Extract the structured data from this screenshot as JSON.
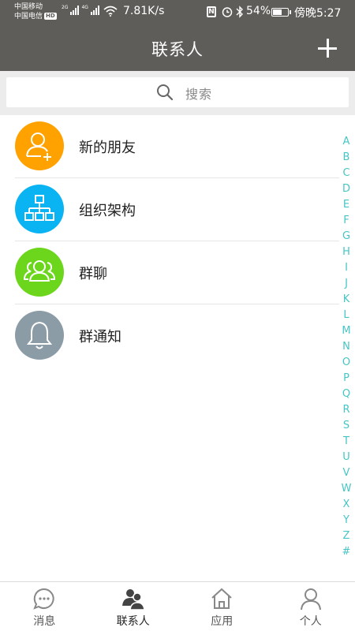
{
  "status_bar": {
    "carrier_1": "中国移动",
    "carrier_2": "中国电信",
    "carrier_2_badge": "HD",
    "signal_1_tag": "2G",
    "signal_2_tag": "4G",
    "net_speed": "7.81K/s",
    "nfc_glyph": "N",
    "battery_percent": "54%",
    "battery_level": 0.54,
    "time": "傍晚5:27"
  },
  "header": {
    "title": "联系人",
    "add_icon": "plus-icon"
  },
  "search": {
    "placeholder": "搜索",
    "icon": "search-icon"
  },
  "contacts_menu": [
    {
      "label": "新的朋友",
      "icon": "add-user-icon",
      "color": "#ffa200"
    },
    {
      "label": "组织架构",
      "icon": "org-chart-icon",
      "color": "#0ab4f2"
    },
    {
      "label": "群聊",
      "icon": "group-icon",
      "color": "#6cd61c"
    },
    {
      "label": "群通知",
      "icon": "bell-icon",
      "color": "#8b9ca7"
    }
  ],
  "alpha_index": [
    "A",
    "B",
    "C",
    "D",
    "E",
    "F",
    "G",
    "H",
    "I",
    "J",
    "K",
    "L",
    "M",
    "N",
    "O",
    "P",
    "Q",
    "R",
    "S",
    "T",
    "U",
    "V",
    "W",
    "X",
    "Y",
    "Z",
    "#"
  ],
  "alpha_color": "#45c6c4",
  "bottom_nav": [
    {
      "label": "消息",
      "icon": "chat-icon",
      "active": false
    },
    {
      "label": "联系人",
      "icon": "contacts-icon",
      "active": true
    },
    {
      "label": "应用",
      "icon": "home-icon",
      "active": false
    },
    {
      "label": "个人",
      "icon": "person-icon",
      "active": false
    }
  ],
  "theme": {
    "header_bg": "#5f5d59",
    "search_bg": "#ececec"
  }
}
